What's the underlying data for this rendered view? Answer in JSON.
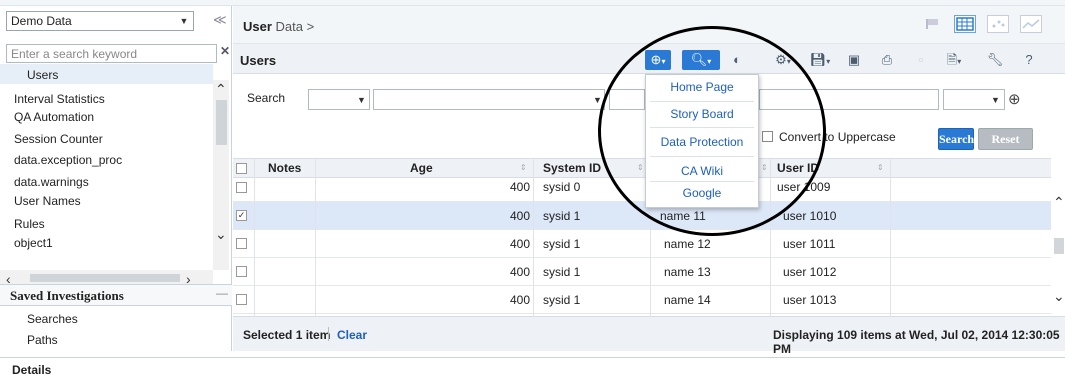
{
  "left_panel": {
    "datasource": "Demo Data",
    "search_placeholder": "Enter a search keyword",
    "tree_items": [
      "Users",
      "Interval Statistics",
      "QA Automation",
      "Session Counter",
      "data.exception_proc",
      "data.warnings",
      "User Names",
      "Rules",
      "object1"
    ],
    "saved_investigations": {
      "title": "Saved Investigations",
      "items": [
        "Searches",
        "Paths"
      ]
    }
  },
  "details": {
    "label": "Details"
  },
  "breadcrumb": {
    "bold": "User",
    "rest": " Data >"
  },
  "panel_title": "Users",
  "search": {
    "label": "Search",
    "uppercase_label": "Convert to Uppercase",
    "search_button": "Search",
    "reset_button": "Reset"
  },
  "table": {
    "headers": [
      "Notes",
      "Age",
      "System ID",
      "",
      "User ID"
    ],
    "rows": [
      {
        "checked": false,
        "age": "400",
        "system_id": "sysid 0",
        "name": "",
        "user_id": "user 1009"
      },
      {
        "checked": true,
        "age": "400",
        "system_id": "sysid 1",
        "name": "name 11",
        "user_id": "user 1010"
      },
      {
        "checked": false,
        "age": "400",
        "system_id": "sysid 1",
        "name": "name 12",
        "user_id": "user 1011"
      },
      {
        "checked": false,
        "age": "400",
        "system_id": "sysid 1",
        "name": "name 13",
        "user_id": "user 1012"
      },
      {
        "checked": false,
        "age": "400",
        "system_id": "sysid 1",
        "name": "name 14",
        "user_id": "user 1013"
      }
    ]
  },
  "footer": {
    "selected": "Selected 1 item",
    "clear": "Clear",
    "displaying": "Displaying 109 items at Wed, Jul 02, 2014 12:30:05 PM"
  },
  "dropdown_menu": {
    "items": [
      "Home Page",
      "Story Board",
      "Data Protection",
      "CA Wiki",
      "Google"
    ]
  },
  "colors": {
    "accent": "#2a7ad5",
    "link": "#1f5fbf",
    "selected_row": "#dce7f7"
  }
}
